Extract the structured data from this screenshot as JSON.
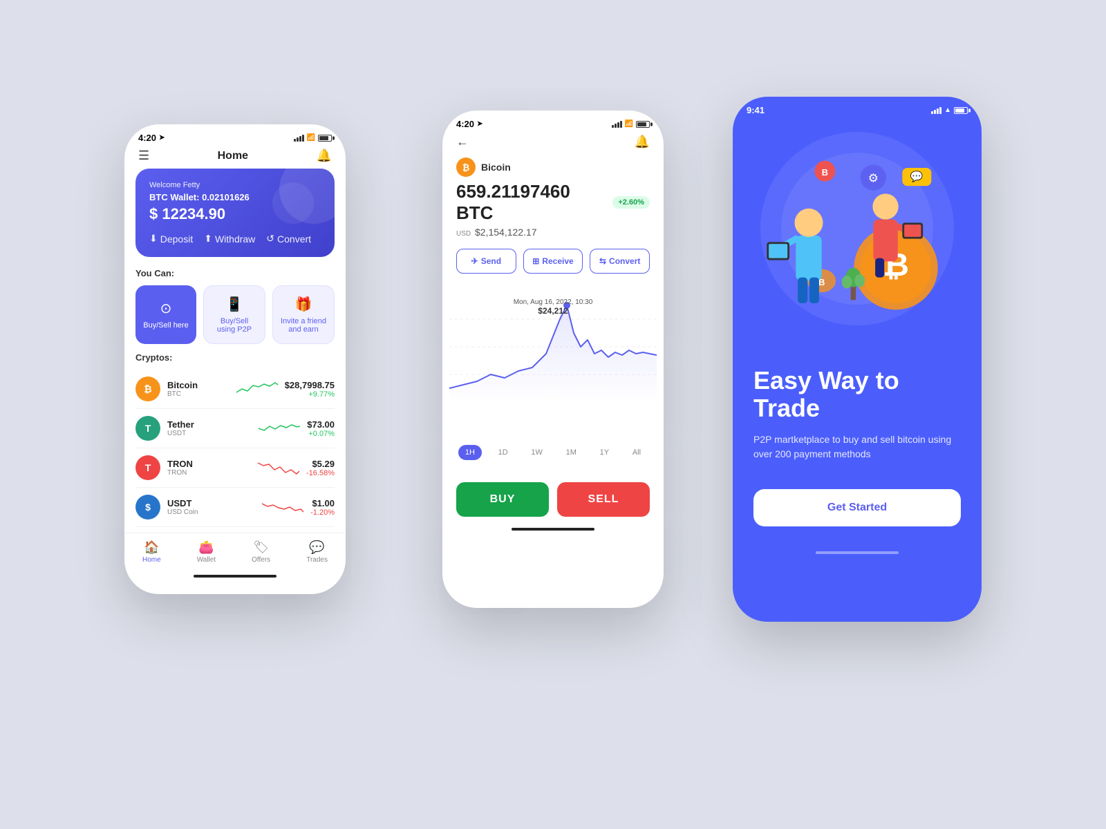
{
  "left_phone": {
    "status": {
      "time": "4:20",
      "location_arrow": "➤"
    },
    "header": {
      "title": "Home",
      "bell": "🔔"
    },
    "wallet": {
      "welcome": "Welcome Fetty",
      "address_label": "BTC Wallet:",
      "address": "0.02101626",
      "amount": "$ 12234.90",
      "deposit": "Deposit",
      "withdraw": "Withdraw",
      "convert": "Convert"
    },
    "you_can": {
      "title": "You Can:",
      "items": [
        {
          "label": "Buy/Sell here",
          "icon": "⊙"
        },
        {
          "label": "Buy/Sell using P2P",
          "icon": "📱"
        },
        {
          "label": "Invite a friend and earn",
          "icon": "🎁"
        }
      ]
    },
    "cryptos": {
      "title": "Cryptos:",
      "items": [
        {
          "name": "Bitcoin",
          "symbol": "BTC",
          "price": "$28,7998.75",
          "change": "+9.77%",
          "positive": true,
          "color": "#F7931A",
          "letter": "₿"
        },
        {
          "name": "Tether",
          "symbol": "USDT",
          "price": "$73.00",
          "change": "+0.07%",
          "positive": true,
          "color": "#26A17B",
          "letter": "T"
        },
        {
          "name": "TRON",
          "symbol": "TRON",
          "price": "$5.29",
          "change": "-16.58%",
          "positive": false,
          "color": "#EF4444",
          "letter": "T"
        },
        {
          "name": "USDT",
          "symbol": "USD Coin",
          "price": "$1.00",
          "change": "-1.20%",
          "positive": false,
          "color": "#2775CA",
          "letter": "$"
        }
      ]
    },
    "nav": [
      {
        "label": "Home",
        "icon": "🏠",
        "active": true
      },
      {
        "label": "Wallet",
        "icon": "👛",
        "active": false
      },
      {
        "label": "Offers",
        "icon": "🏷",
        "active": false
      },
      {
        "label": "Trades",
        "icon": "💬",
        "active": false
      }
    ]
  },
  "middle_phone": {
    "status": {
      "time": "4:20"
    },
    "coin": {
      "name": "Bicoin",
      "amount": "659.21197460 BTC",
      "badge": "+2.60%",
      "usd_label": "USD",
      "usd_amount": "$2,154,122.17"
    },
    "actions": [
      {
        "label": "Send",
        "icon": "✈"
      },
      {
        "label": "Receive",
        "icon": "⊞"
      },
      {
        "label": "Convert",
        "icon": "⇆"
      }
    ],
    "chart": {
      "tooltip_date": "Mon, Aug 16, 2022, 10:30",
      "tooltip_price": "$24,212"
    },
    "time_tabs": [
      "1H",
      "1D",
      "1W",
      "1M",
      "1Y",
      "All"
    ],
    "active_tab": "1H",
    "buy_label": "BUY",
    "sell_label": "SELL"
  },
  "right_phone": {
    "status": {
      "time": "9:41"
    },
    "title_line1": "Easy Way to",
    "title_line2": "Trade",
    "subtitle": "P2P martketplace to buy and sell bitcoin using  over 200 payment methods",
    "cta": "Get Started"
  }
}
